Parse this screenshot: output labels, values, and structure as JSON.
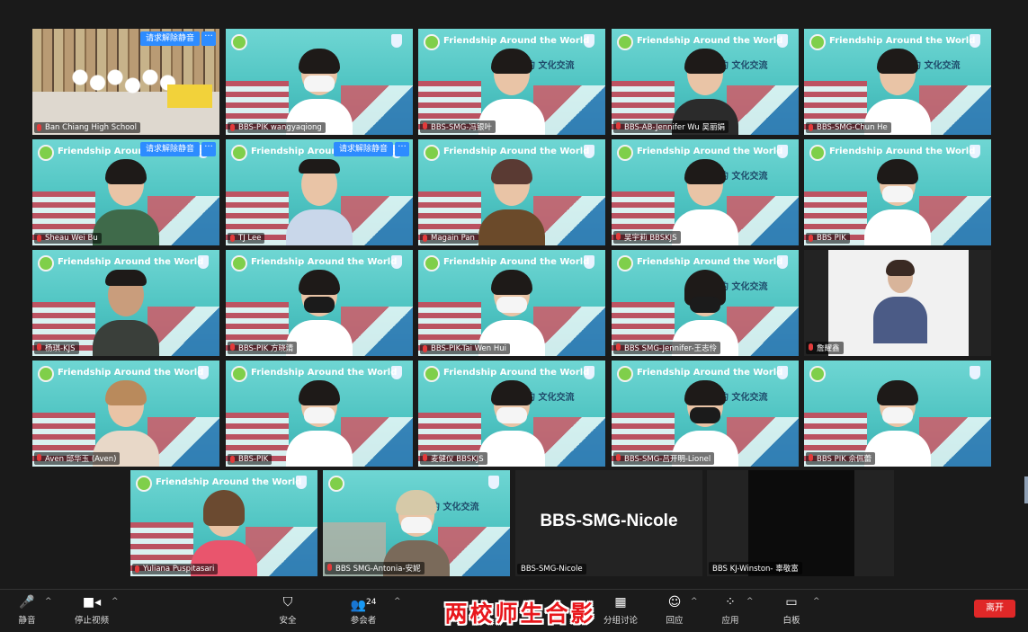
{
  "tile_banner": {
    "title": "Friendship Around the World",
    "subtitle_cn": "云端相约 文化交流"
  },
  "unmute_label": "请求解除静音",
  "more_label": "···",
  "tiles": [
    {
      "name": "Ban Chiang High School"
    },
    {
      "name": "BBS-PIK wangyaqiong"
    },
    {
      "name": "BBS-SMG-冯银叶"
    },
    {
      "name": "BBS-AB-Jennifer Wu 吴丽娟"
    },
    {
      "name": "BBS-SMG-Chun He"
    },
    {
      "name": "Sheau Wei Bu"
    },
    {
      "name": "TJ Lee"
    },
    {
      "name": "Magain Pan"
    },
    {
      "name": "吴宇莉 BBSKJS"
    },
    {
      "name": "BBS PIK"
    },
    {
      "name": "杨琪-KJS"
    },
    {
      "name": "BBS-PIK 方晓清"
    },
    {
      "name": "BBS-PIK-Tai Wen Hui"
    },
    {
      "name": "BBS SMG-Jennifer-王志伶"
    },
    {
      "name": "詹耀鑫"
    },
    {
      "name": "Aven 邱华玉 (Aven)"
    },
    {
      "name": "BBS-PIK"
    },
    {
      "name": "麦健仪 BBSKJS"
    },
    {
      "name": "BBS-SMG-吕开明-Lionel"
    },
    {
      "name": "BBS PIK 佘佩蕾"
    },
    {
      "name": "Yuliana Puspitasari"
    },
    {
      "name": "BBS SMG-Antonia-安妮"
    },
    {
      "name": "BBS-SMG-Nicole"
    },
    {
      "name": "BBS KJ-Winston- 辜敬富"
    }
  ],
  "nicole_big_label": "BBS-SMG-Nicole",
  "toolbar": {
    "mute": "静音",
    "stop_video": "停止视频",
    "security": "安全",
    "participants": "参会者",
    "participants_count": "24",
    "breakout": "分组讨论",
    "reactions": "回应",
    "apps": "应用",
    "whiteboard": "白板",
    "leave": "离开"
  },
  "caption": "两校师生合影",
  "colors": {
    "accent": "#2d8cff",
    "leave": "#e02828",
    "caption": "#e8171c",
    "banner_bg": "#4fc4c2"
  }
}
